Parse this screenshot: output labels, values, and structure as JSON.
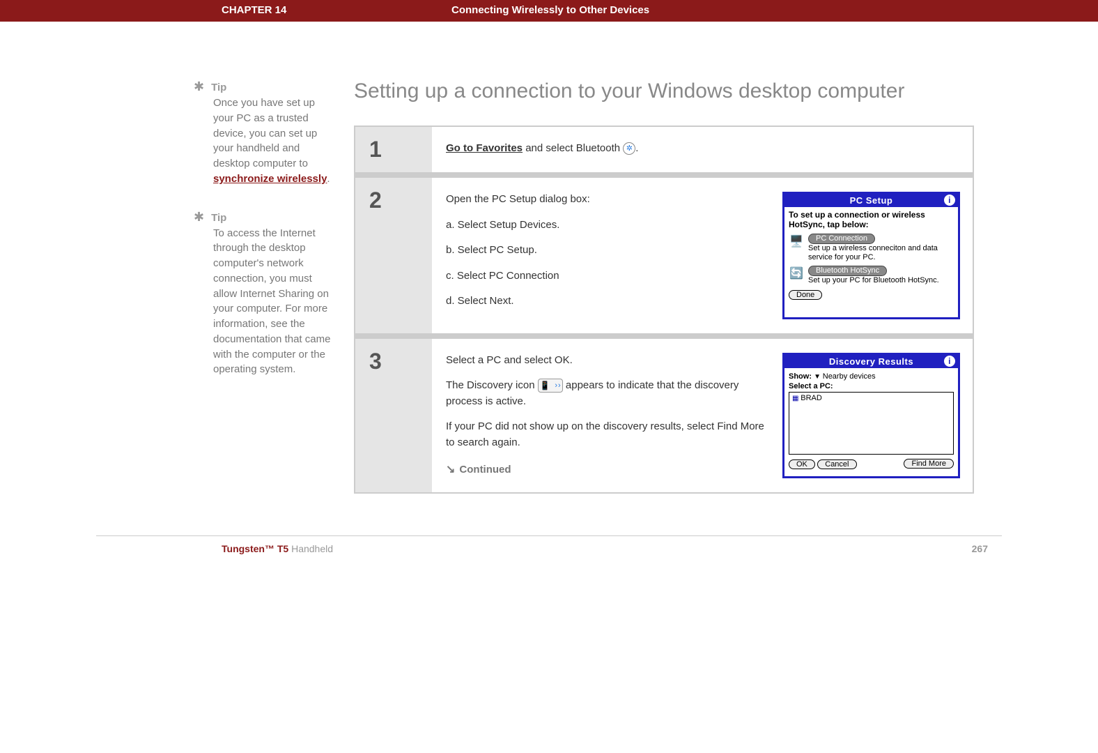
{
  "header": {
    "chapter": "CHAPTER 14",
    "title": "Connecting Wirelessly to Other Devices"
  },
  "section_title": "Setting up a connection to your Windows desktop computer",
  "tips": [
    {
      "label": "Tip",
      "pre": "Once you have set up your PC as a trusted device, you can set up your handheld and desktop computer to ",
      "link": "synchronize wirelessly",
      "post": "."
    },
    {
      "label": "Tip",
      "pre": "To access the Internet through the desktop computer's network connection, you must allow Internet Sharing on your computer. For more information, see the documentation that came with the computer or the operating system.",
      "link": "",
      "post": ""
    }
  ],
  "steps": {
    "s1": {
      "num": "1",
      "link": "Go to Favorites",
      "rest": " and select Bluetooth ",
      "trail": "."
    },
    "s2": {
      "num": "2",
      "lead": "Open the PC Setup dialog box:",
      "a": "a.  Select Setup Devices.",
      "b": "b.  Select PC Setup.",
      "c": "c.  Select PC Connection",
      "d": "d.  Select Next."
    },
    "s3": {
      "num": "3",
      "p1": "Select a PC and select OK.",
      "p2a": "The Discovery icon ",
      "p2b": " appears to indicate that the discovery process is active.",
      "p3": "If your PC did not show up on the discovery results, select Find More to search again.",
      "continued": "Continued"
    }
  },
  "device1": {
    "title": "PC Setup",
    "instr": "To set up a connection or wireless HotSync, tap below:",
    "btn1": "PC Connection",
    "desc1": "Set up a wireless conneciton and data service for your PC.",
    "btn2": "Bluetooth HotSync",
    "desc2": "Set up your PC for Bluetooth HotSync.",
    "done": "Done"
  },
  "device2": {
    "title": "Discovery Results",
    "show_label": "Show:",
    "show_value": "Nearby devices",
    "select_label": "Select a PC:",
    "item": "BRAD",
    "ok": "OK",
    "cancel": "Cancel",
    "findmore": "Find More"
  },
  "footer": {
    "brand": "Tungsten™ T5",
    "product": " Handheld",
    "page": "267"
  }
}
